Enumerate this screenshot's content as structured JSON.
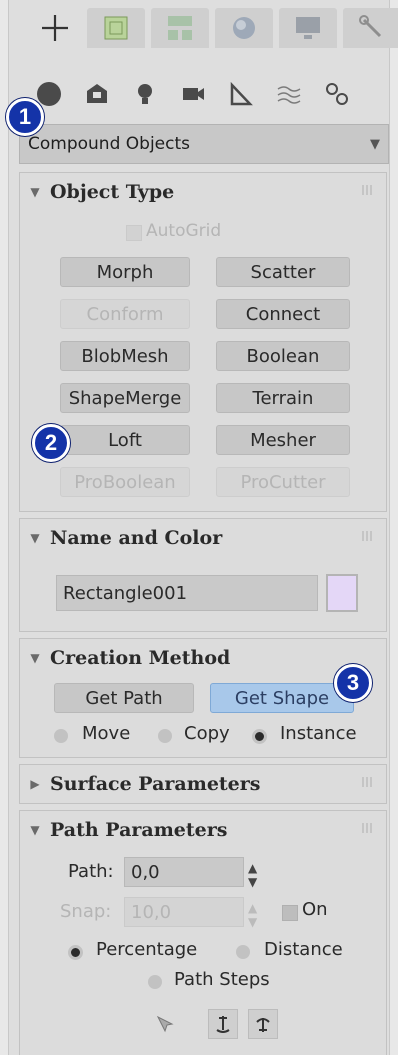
{
  "top_tabs": [
    {
      "name": "create-tab",
      "icon": "plus-icon"
    },
    {
      "name": "modify-tab",
      "icon": "modify-icon"
    },
    {
      "name": "hierarchy-tab",
      "icon": "hierarchy-icon"
    },
    {
      "name": "motion-tab",
      "icon": "motion-icon"
    },
    {
      "name": "display-tab",
      "icon": "display-icon"
    },
    {
      "name": "utilities-tab",
      "icon": "wrench-icon"
    }
  ],
  "categories": [
    "geometry-icon",
    "shapes-icon",
    "lights-icon",
    "cameras-icon",
    "helpers-icon",
    "spacewarps-icon",
    "systems-icon"
  ],
  "badges": [
    "1",
    "2",
    "3"
  ],
  "dropdown": {
    "value": "Compound Objects"
  },
  "object_type": {
    "title": "Object Type",
    "autogrid": "AutoGrid",
    "buttons": [
      {
        "label": "Morph",
        "enabled": true
      },
      {
        "label": "Scatter",
        "enabled": true
      },
      {
        "label": "Conform",
        "enabled": false
      },
      {
        "label": "Connect",
        "enabled": true
      },
      {
        "label": "BlobMesh",
        "enabled": true
      },
      {
        "label": "Boolean",
        "enabled": true
      },
      {
        "label": "ShapeMerge",
        "enabled": true
      },
      {
        "label": "Terrain",
        "enabled": true
      },
      {
        "label": "Loft",
        "enabled": true
      },
      {
        "label": "Mesher",
        "enabled": true
      },
      {
        "label": "ProBoolean",
        "enabled": false
      },
      {
        "label": "ProCutter",
        "enabled": false
      }
    ]
  },
  "name_color": {
    "title": "Name and Color",
    "name_value": "Rectangle001",
    "color": "#e4d7f7"
  },
  "creation_method": {
    "title": "Creation Method",
    "get_path": "Get Path",
    "get_shape": "Get Shape",
    "move": "Move",
    "copy": "Copy",
    "instance": "Instance",
    "selected": "Instance"
  },
  "surface_parameters": {
    "title": "Surface Parameters"
  },
  "path_parameters": {
    "title": "Path Parameters",
    "path_label": "Path:",
    "path_value": "0,0",
    "snap_label": "Snap:",
    "snap_value": "10,0",
    "on_label": "On",
    "percentage": "Percentage",
    "distance": "Distance",
    "path_steps": "Path Steps",
    "selected": "Percentage"
  },
  "colors": {
    "accent": "#1433a8",
    "highlight": "#a8c8ea"
  }
}
